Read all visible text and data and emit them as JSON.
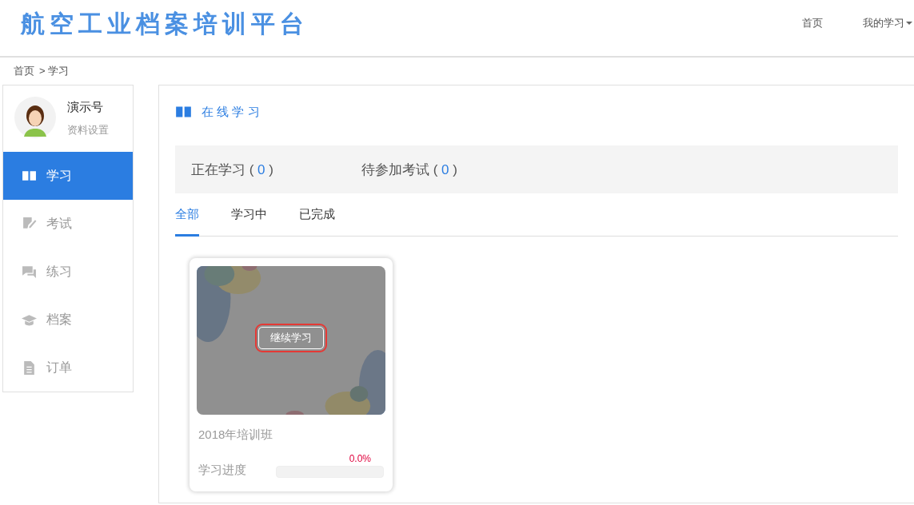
{
  "header": {
    "logo": "航空工业档案培训平台",
    "nav": [
      {
        "label": "首页",
        "dropdown": false
      },
      {
        "label": "我的学习",
        "dropdown": true
      }
    ]
  },
  "breadcrumb": [
    "首页",
    "> 学习"
  ],
  "profile": {
    "name": "演示号",
    "settings_link": "资料设置"
  },
  "sidebar": {
    "items": [
      {
        "label": "学习",
        "kind": "book",
        "selected": true
      },
      {
        "label": "考试",
        "kind": "edit",
        "selected": false
      },
      {
        "label": "练习",
        "kind": "chat",
        "selected": false
      },
      {
        "label": "档案",
        "kind": "cap",
        "selected": false
      },
      {
        "label": "订单",
        "kind": "file",
        "selected": false
      }
    ]
  },
  "section_title": "在 线 学 习",
  "stats": [
    {
      "label": "正在学习",
      "open": "(",
      "count": "0",
      "close": ")"
    },
    {
      "label": "待参加考试",
      "open": "(",
      "count": "0",
      "close": ")"
    }
  ],
  "tabs": [
    {
      "label": "全部",
      "selected": true
    },
    {
      "label": "学习中",
      "selected": false
    },
    {
      "label": "已完成",
      "selected": false
    }
  ],
  "courses": [
    {
      "kind": "picture",
      "button": "继续学习",
      "highlighted": true,
      "title": "2018年培训班",
      "progress_label": "学习进度",
      "percent": "0.0%",
      "level": 0
    }
  ]
}
